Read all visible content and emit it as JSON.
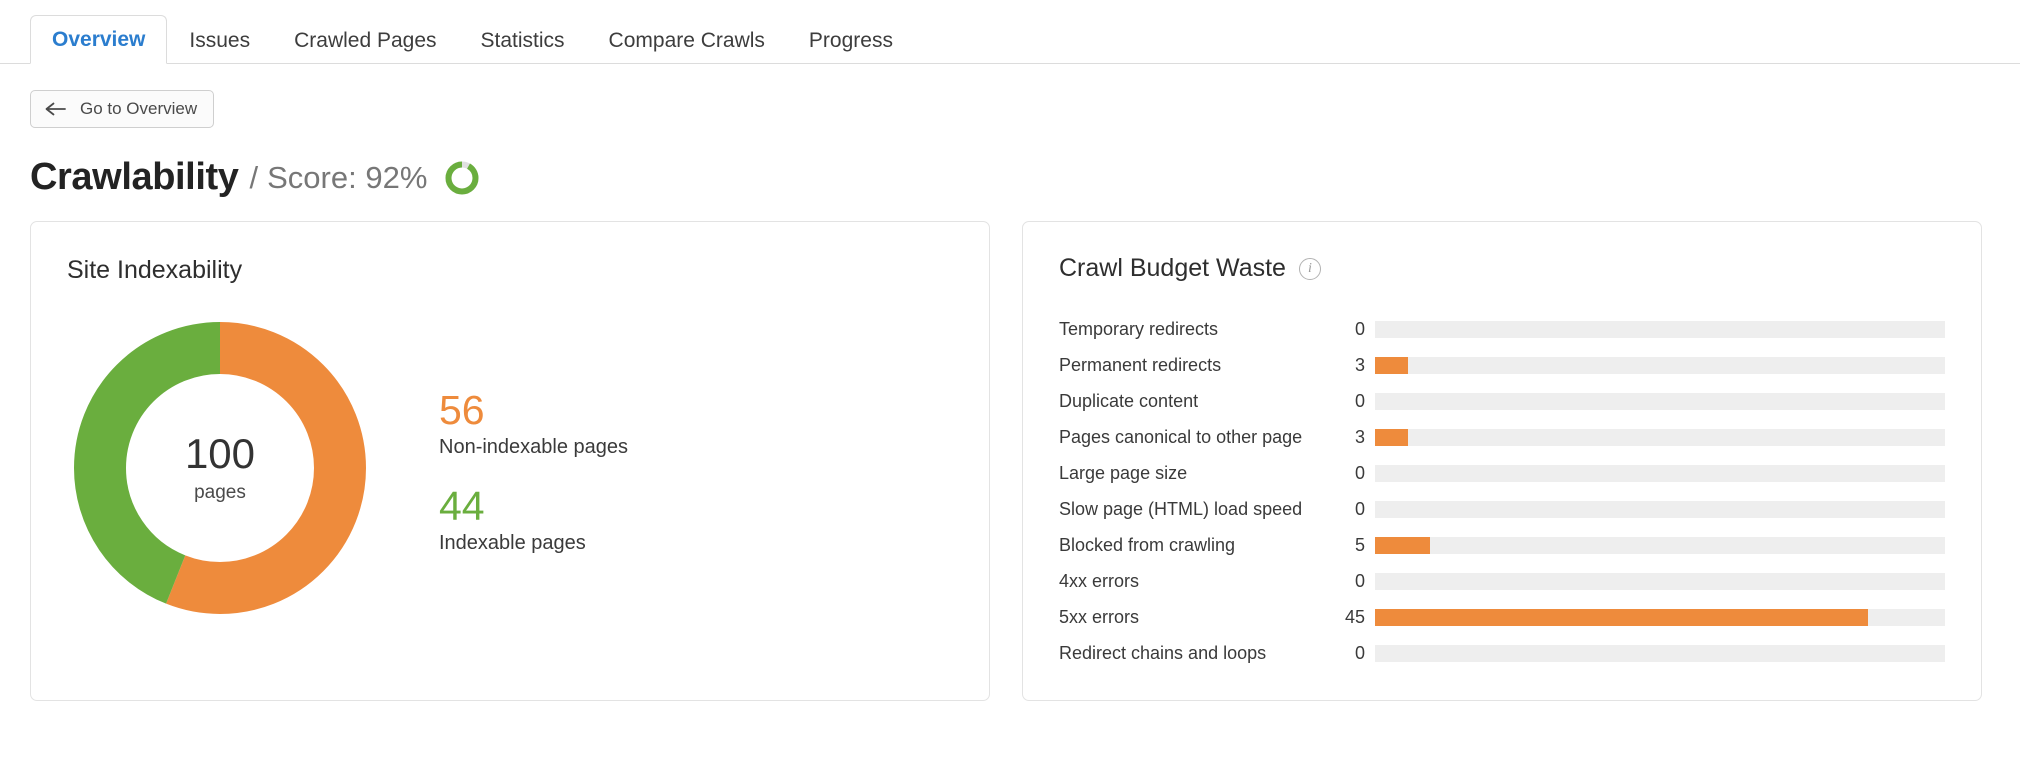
{
  "tabs": [
    {
      "label": "Overview",
      "active": true
    },
    {
      "label": "Issues",
      "active": false
    },
    {
      "label": "Crawled Pages",
      "active": false
    },
    {
      "label": "Statistics",
      "active": false
    },
    {
      "label": "Compare Crawls",
      "active": false
    },
    {
      "label": "Progress",
      "active": false
    }
  ],
  "back_button": {
    "label": "Go to Overview",
    "icon": "arrow-left-icon"
  },
  "header": {
    "title": "Crawlability",
    "separator": "/",
    "score_text": "Score: 92%",
    "score_value": 92,
    "score_color": "#6aae3e",
    "score_track_color": "#e0e0e0"
  },
  "colors": {
    "orange": "#ee8b3c",
    "green": "#6aae3e",
    "track": "#eeeeee",
    "accent_blue": "#2b7dce"
  },
  "site_indexability": {
    "title": "Site Indexability",
    "center_value": "100",
    "center_unit": "pages",
    "non_indexable": {
      "value": "56",
      "label": "Non-indexable pages",
      "color": "#ee8b3c"
    },
    "indexable": {
      "value": "44",
      "label": "Indexable pages",
      "color": "#6aae3e"
    }
  },
  "crawl_budget_waste": {
    "title": "Crawl Budget Waste",
    "info_icon": "info-icon",
    "info_glyph": "i"
  },
  "chart_data": [
    {
      "type": "pie",
      "title": "Site Indexability",
      "labels": [
        "Non-indexable pages",
        "Indexable pages"
      ],
      "values": [
        56,
        44
      ],
      "colors": [
        "#ee8b3c",
        "#6aae3e"
      ],
      "total": 100,
      "total_unit": "pages",
      "start_angle_deg": 0,
      "direction": "clockwise",
      "donut": true,
      "legend": "right"
    },
    {
      "type": "bar",
      "orientation": "horizontal",
      "title": "Crawl Budget Waste",
      "categories": [
        "Temporary redirects",
        "Permanent redirects",
        "Duplicate content",
        "Pages canonical to other page",
        "Large page size",
        "Slow page (HTML) load speed",
        "Blocked from crawling",
        "4xx errors",
        "5xx errors",
        "Redirect chains and loops"
      ],
      "values": [
        0,
        3,
        0,
        3,
        0,
        0,
        5,
        0,
        45,
        0
      ],
      "xlim": [
        0,
        52
      ],
      "bar_color": "#ee8b3c",
      "track_color": "#eeeeee",
      "grid": false,
      "legend": "none",
      "xlabel": "",
      "ylabel": ""
    }
  ],
  "waste_rows": [
    {
      "label": "Temporary redirects",
      "value": "0",
      "pct": 0
    },
    {
      "label": "Permanent redirects",
      "value": "3",
      "pct": 5.8
    },
    {
      "label": "Duplicate content",
      "value": "0",
      "pct": 0
    },
    {
      "label": "Pages canonical to other page",
      "value": "3",
      "pct": 5.8
    },
    {
      "label": "Large page size",
      "value": "0",
      "pct": 0
    },
    {
      "label": "Slow page (HTML) load speed",
      "value": "0",
      "pct": 0
    },
    {
      "label": "Blocked from crawling",
      "value": "5",
      "pct": 9.6
    },
    {
      "label": "4xx errors",
      "value": "0",
      "pct": 0
    },
    {
      "label": "5xx errors",
      "value": "45",
      "pct": 86.5
    },
    {
      "label": "Redirect chains and loops",
      "value": "0",
      "pct": 0
    }
  ]
}
